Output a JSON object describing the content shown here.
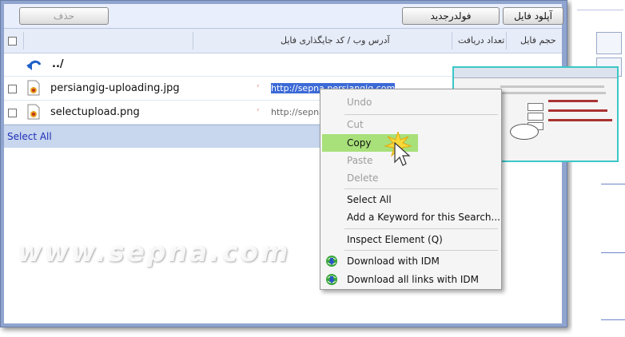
{
  "toolbar": {
    "delete_label": "حذف",
    "new_folder_label": "فولدرجدید",
    "upload_label": "آپلود فایل"
  },
  "table": {
    "headers": {
      "size": "حجم فایل",
      "downloads": "تعداد دریافت",
      "url": "آدرس وب / کد جایگذاری فایل"
    },
    "parent_dir": "../",
    "rows": [
      {
        "name": "persiangig-uploading.jpg",
        "url": "http://sepna.persiangig.com"
      },
      {
        "name": "selectupload.png",
        "url": "http://sepna"
      }
    ],
    "select_all": "Select All"
  },
  "context_menu": {
    "undo": "Undo",
    "cut": "Cut",
    "copy": "Copy",
    "paste": "Paste",
    "delete": "Delete",
    "select_all": "Select All",
    "add_keyword": "Add a Keyword for this Search...",
    "inspect": "Inspect Element (Q)",
    "download_idm": "Download with IDM",
    "download_all_idm": "Download all links with IDM"
  },
  "watermark": "www.sepna.com",
  "colors": {
    "accent": "#3c6ad6",
    "highlight": "#a8e07a",
    "ring": "#3fa646",
    "thumb_border": "#3bc7c7"
  }
}
